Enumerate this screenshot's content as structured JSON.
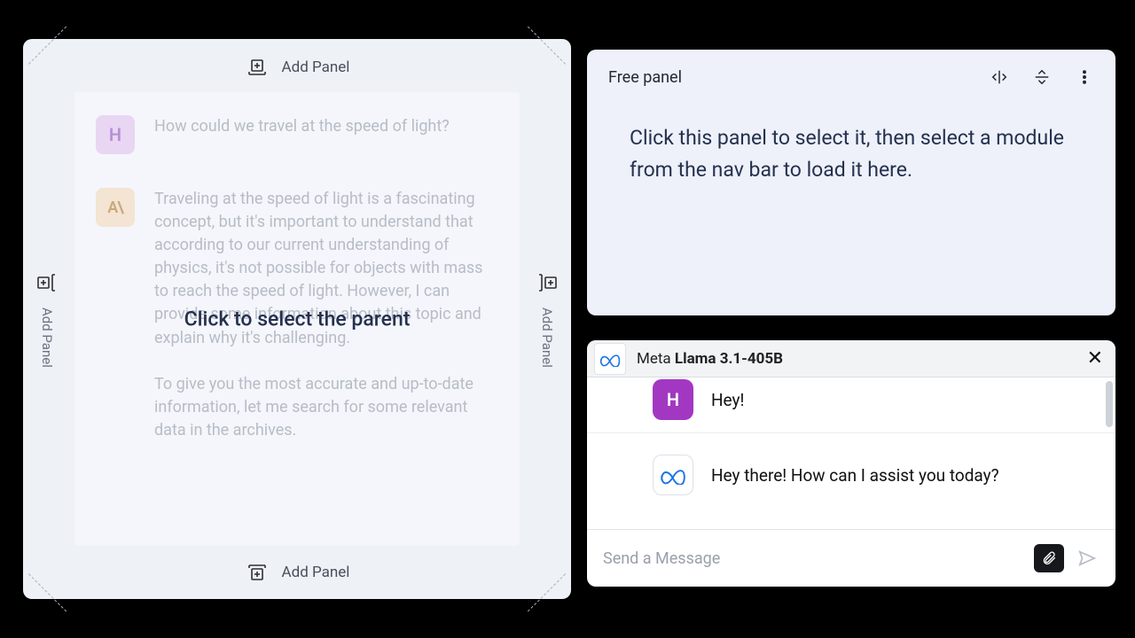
{
  "left": {
    "add_panel_label": "Add Panel",
    "overlay_label": "Click to select the parent",
    "user_msg": "How could we travel at the speed of light?",
    "user_initial": "H",
    "ai_label": "A\\",
    "ai_msg_p1": "Traveling at the speed of light is a fascinating concept, but it's important to understand that according to our current understanding of physics, it's not possible for objects with mass to reach the speed of light. However, I can provide some information about this topic and explain why it's challenging.",
    "ai_msg_p2": "To give you the most accurate and up-to-date information, let me search for some relevant data in the archives."
  },
  "free": {
    "title": "Free panel",
    "body": "Click this panel to select it, then select a module from the nav bar to load it here."
  },
  "chat": {
    "model_prefix": "Meta ",
    "model_bold": "Llama 3.1-405B",
    "user_initial": "H",
    "user_msg": "Hey!",
    "bot_msg": "Hey there! How can I assist you today?",
    "input_placeholder": "Send a Message"
  }
}
